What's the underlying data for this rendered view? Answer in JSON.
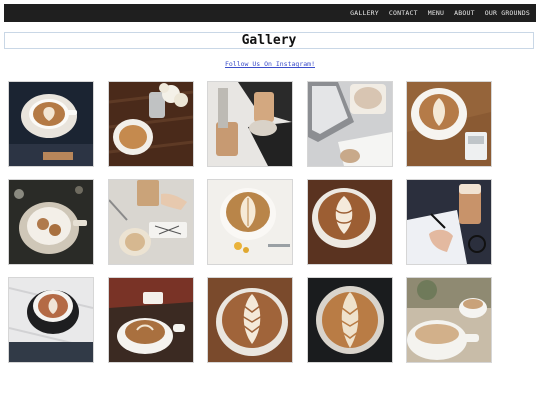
{
  "nav": {
    "items": [
      "GALLERY",
      "CONTACT",
      "MENU",
      "ABOUT",
      "OUR GROUNDS"
    ]
  },
  "page": {
    "title": "Gallery",
    "instagram_link": "Follow Us On Instagram!"
  },
  "gallery": {
    "rows": 3,
    "cols": 5,
    "photos": [
      "latte-art-cup-dark",
      "coffee-cup-wooden-table",
      "iced-coffee-friends",
      "laptop-coffee-desk",
      "latte-art-wood-table",
      "cup-with-cookies",
      "iced-coffee-hand",
      "leaf-latte-art",
      "tulip-latte-art",
      "writing-journal-iced-coffee",
      "espresso-dark-saucer",
      "coffee-cup-hands",
      "fern-latte-art",
      "rosetta-latte-art",
      "white-cup-window"
    ]
  }
}
